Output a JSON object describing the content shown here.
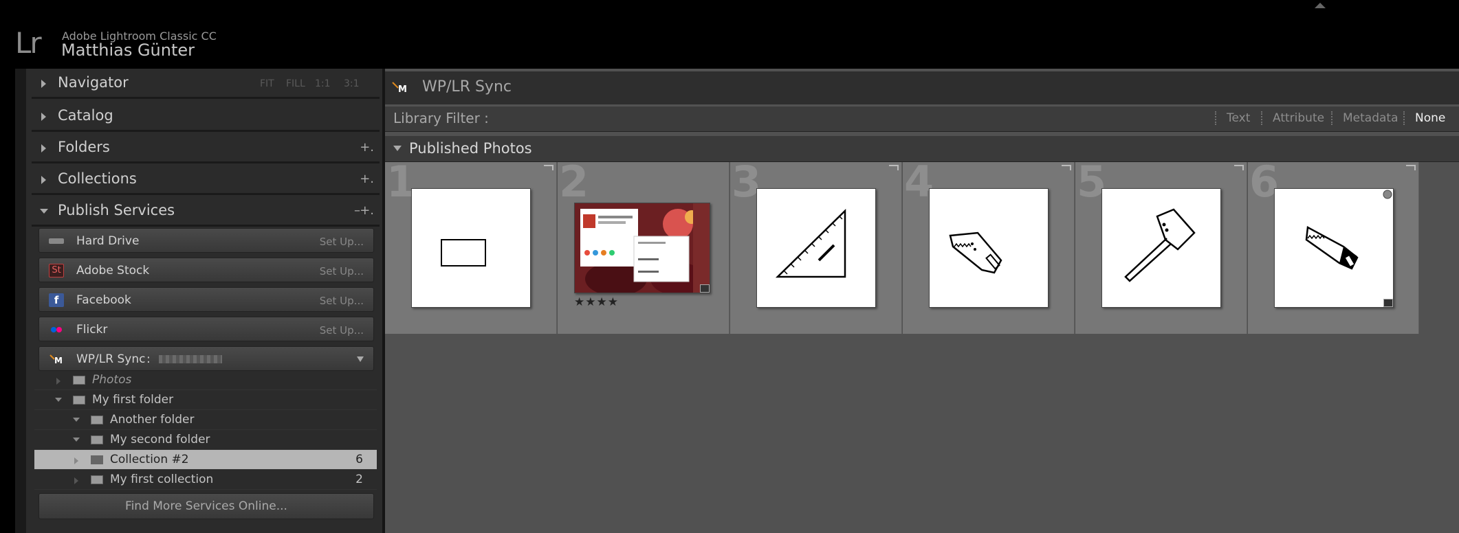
{
  "identity": {
    "logo": "Lr",
    "app_name": "Adobe Lightroom Classic CC",
    "user_name": "Matthias Günter"
  },
  "left_panel": {
    "navigator": {
      "title": "Navigator",
      "zoom_options": [
        "FIT",
        "FILL",
        "1:1",
        "3:1"
      ]
    },
    "catalog": {
      "title": "Catalog"
    },
    "folders": {
      "title": "Folders",
      "add": "+."
    },
    "collections": {
      "title": "Collections",
      "add": "+."
    },
    "publish_services": {
      "title": "Publish Services",
      "remove": "–",
      "add": "+.",
      "services": [
        {
          "name": "Hard Drive",
          "action": "Set Up...",
          "icon": "hard-drive-icon",
          "color": "#888888"
        },
        {
          "name": "Adobe Stock",
          "action": "Set Up...",
          "icon": "adobe-stock-icon",
          "color": "#3b1e1e"
        },
        {
          "name": "Facebook",
          "action": "Set Up...",
          "icon": "facebook-icon",
          "color": "#3b5998"
        },
        {
          "name": "Flickr",
          "action": "Set Up...",
          "icon": "flickr-icon",
          "color": "#ff0084"
        }
      ],
      "wplr": {
        "name": "WP/LR Sync",
        "separator": ":",
        "icon": "wplr-icon"
      },
      "tree": [
        {
          "label": "Photos",
          "count": ""
        },
        {
          "label": "My first folder",
          "count": ""
        },
        {
          "label": "Another folder",
          "count": ""
        },
        {
          "label": "My second folder",
          "count": ""
        },
        {
          "label": "Collection #2",
          "count": "6"
        },
        {
          "label": "My first collection",
          "count": "2"
        }
      ],
      "find_more": "Find More Services Online..."
    }
  },
  "center": {
    "title_logo": "M",
    "title": "WP/LR Sync",
    "filter_label": "Library Filter :",
    "filters": [
      "Text",
      "Attribute",
      "Metadata",
      "None"
    ],
    "active_filter": "None",
    "section_title": "Published Photos",
    "grid": [
      {
        "number": "1",
        "icon": "rectangle-icon",
        "stars": ""
      },
      {
        "number": "2",
        "icon": "wordpress-screenshot-photo",
        "stars": "★★★★"
      },
      {
        "number": "3",
        "icon": "set-square-icon",
        "stars": ""
      },
      {
        "number": "4",
        "icon": "saw-icon",
        "stars": ""
      },
      {
        "number": "5",
        "icon": "axe-icon",
        "stars": ""
      },
      {
        "number": "6",
        "icon": "saw-icon",
        "stars": ""
      }
    ]
  }
}
